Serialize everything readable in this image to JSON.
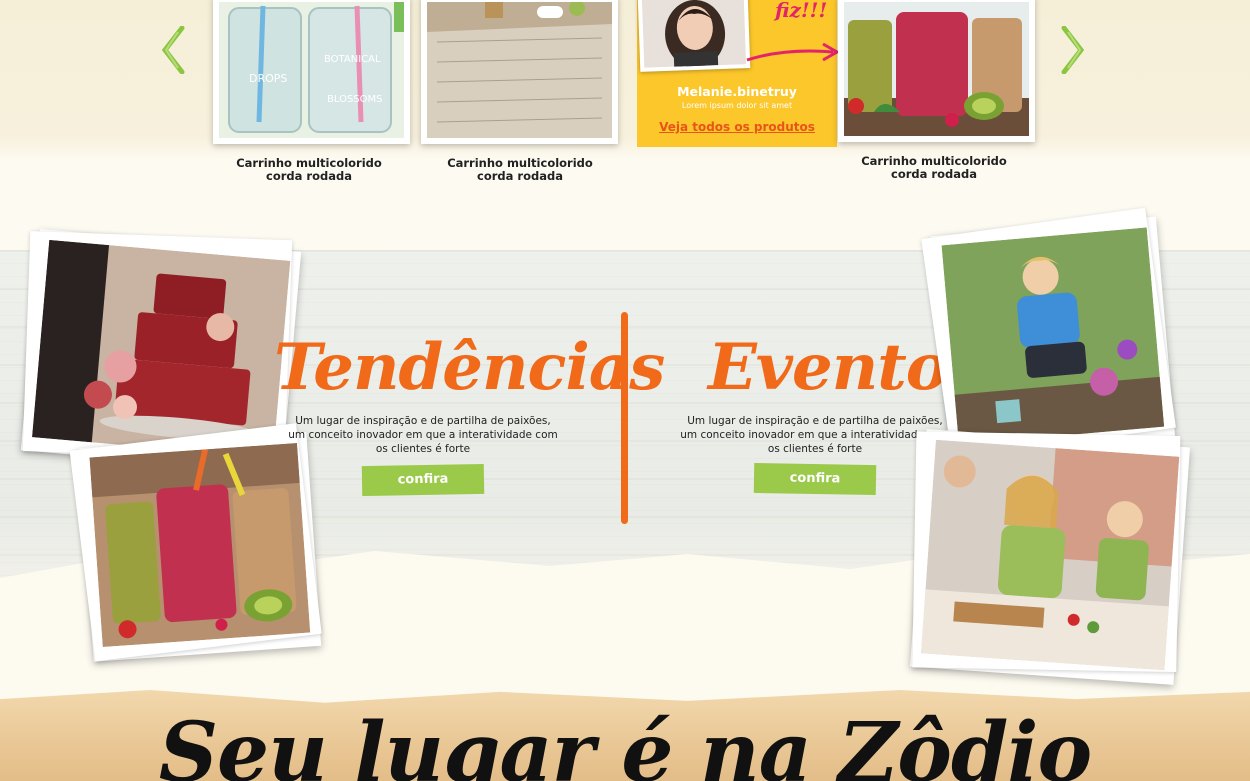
{
  "carousel": {
    "items": [
      {
        "caption_line1": "Carrinho multicolorido",
        "caption_line2": "corda rodada"
      },
      {
        "caption_line1": "Carrinho multicolorido",
        "caption_line2": "corda rodada"
      },
      {
        "caption_line1": "Carrinho multicolorido",
        "caption_line2": "corda rodada"
      }
    ],
    "promo": {
      "badge": "fiz!!!",
      "name": "Melanie.binetruy",
      "subtitle": "Lorem ipsum dolor sit amet",
      "link": "Veja todos os produtos"
    },
    "icons": {
      "prev": "chevron-left-icon",
      "next": "chevron-right-icon"
    }
  },
  "sections": {
    "tendencias": {
      "title": "Tendências",
      "description": "Um lugar de inspiração e de partilha de paixões, um conceito inovador em que a interatividade com os clientes é forte",
      "button": "confira"
    },
    "eventos": {
      "title": "Eventos",
      "description": "Um lugar de inspiração e de partilha de paixões, um conceito inovador em que a interatividade com os clientes é forte",
      "button": "confira"
    }
  },
  "banner": {
    "title": "Seu lugar é na Zôdio"
  },
  "colors": {
    "accent_orange": "#f06a1a",
    "button_green": "#9bc94a",
    "promo_yellow": "#fcc72b",
    "arrow_green": "#8cc63f",
    "badge_pink": "#e2246a"
  }
}
